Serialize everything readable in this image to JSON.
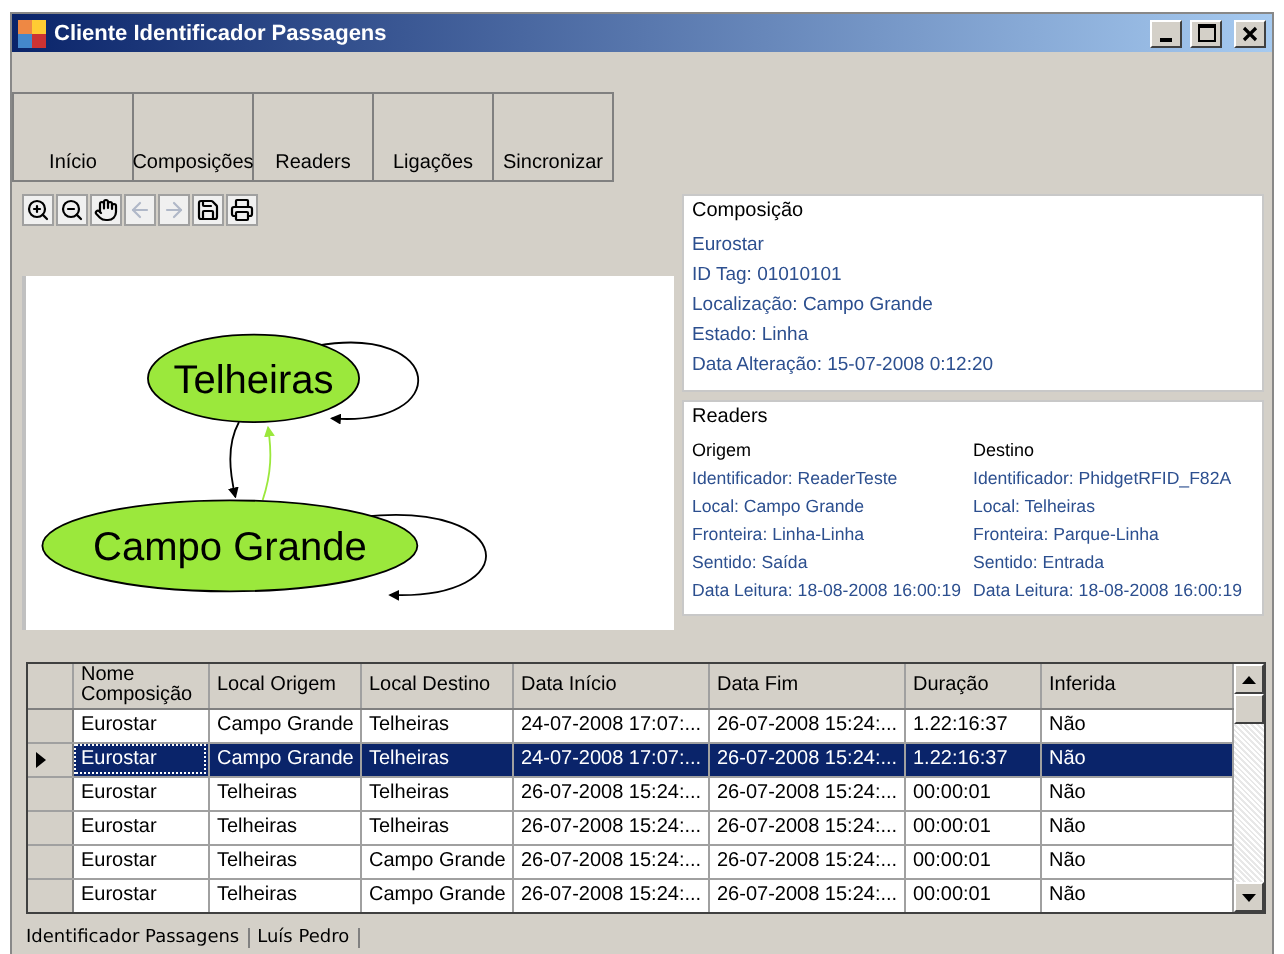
{
  "window": {
    "title": "Cliente Identificador Passagens"
  },
  "toolbar": [
    {
      "label": "Início"
    },
    {
      "label": "Composições"
    },
    {
      "label": "Readers"
    },
    {
      "label": "Ligações"
    },
    {
      "label": "Sincronizar"
    }
  ],
  "graph_toolbar": [
    {
      "kind": "zoom-in",
      "disabled": false
    },
    {
      "kind": "zoom-out",
      "disabled": false
    },
    {
      "kind": "pan",
      "disabled": false
    },
    {
      "kind": "back",
      "disabled": true
    },
    {
      "kind": "forward",
      "disabled": true
    },
    {
      "kind": "save",
      "disabled": false
    },
    {
      "kind": "print",
      "disabled": false
    }
  ],
  "graph": {
    "nodes": [
      {
        "label": "Telheiras"
      },
      {
        "label": "Campo Grande"
      }
    ]
  },
  "composicao": {
    "title": "Composição",
    "lines": [
      "Eurostar",
      "ID Tag: 01010101",
      "Localização: Campo Grande",
      "Estado: Linha",
      "Data Alteração: 15-07-2008 0:12:20"
    ]
  },
  "readers": {
    "title": "Readers",
    "columns": [
      {
        "heading": "Origem",
        "lines": [
          "Identificador: ReaderTeste",
          "Local: Campo Grande",
          "Fronteira: Linha-Linha",
          "Sentido: Saída",
          "Data Leitura: 18-08-2008 16:00:19"
        ]
      },
      {
        "heading": "Destino",
        "lines": [
          "Identificador: PhidgetRFID_F82A",
          "Local: Telheiras",
          "Fronteira: Parque-Linha",
          "Sentido: Entrada",
          "Data Leitura: 18-08-2008 16:00:19"
        ]
      }
    ]
  },
  "table": {
    "columns": [
      "Nome Composição",
      "Local Origem",
      "Local Destino",
      "Data Início",
      "Data Fim",
      "Duração",
      "Inferida"
    ],
    "rows": [
      {
        "selected": false,
        "cells": [
          "Eurostar",
          "Campo Grande",
          "Telheiras",
          "24-07-2008 17:07:...",
          "26-07-2008 15:24:...",
          "1.22:16:37",
          "Não"
        ]
      },
      {
        "selected": true,
        "cells": [
          "Eurostar",
          "Campo Grande",
          "Telheiras",
          "24-07-2008 17:07:...",
          "26-07-2008 15:24:...",
          "1.22:16:37",
          "Não"
        ]
      },
      {
        "selected": false,
        "cells": [
          "Eurostar",
          "Telheiras",
          "Telheiras",
          "26-07-2008 15:24:...",
          "26-07-2008 15:24:...",
          "00:00:01",
          "Não"
        ]
      },
      {
        "selected": false,
        "cells": [
          "Eurostar",
          "Telheiras",
          "Telheiras",
          "26-07-2008 15:24:...",
          "26-07-2008 15:24:...",
          "00:00:01",
          "Não"
        ]
      },
      {
        "selected": false,
        "cells": [
          "Eurostar",
          "Telheiras",
          "Campo Grande",
          "26-07-2008 15:24:...",
          "26-07-2008 15:24:...",
          "00:00:01",
          "Não"
        ]
      },
      {
        "selected": false,
        "cells": [
          "Eurostar",
          "Telheiras",
          "Campo Grande",
          "26-07-2008 15:24:...",
          "26-07-2008 15:24:...",
          "00:00:01",
          "Não"
        ]
      }
    ]
  },
  "status_bar": [
    "Identificador Passagens",
    "Luís Pedro"
  ]
}
